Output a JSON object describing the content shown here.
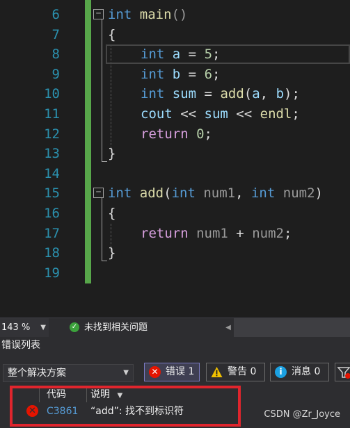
{
  "editor": {
    "line_numbers": [
      "6",
      "7",
      "8",
      "9",
      "10",
      "11",
      "12",
      "13",
      "14",
      "15",
      "16",
      "17",
      "18",
      "19"
    ],
    "code": {
      "l6": {
        "type": "int",
        "name": "main",
        "parens": "()"
      },
      "l7": "{",
      "l8": {
        "type": "int",
        "var": "a",
        "op": " = ",
        "val": "5",
        "end": ";"
      },
      "l9": {
        "type": "int",
        "var": "b",
        "op": " = ",
        "val": "6",
        "end": ";"
      },
      "l10": {
        "type": "int",
        "var": "sum",
        "op": " = ",
        "call": "add",
        "open": "(",
        "a1": "a",
        "sep": ", ",
        "a2": "b",
        "close": ");"
      },
      "l11": {
        "cout": "cout",
        "op1": " << ",
        "var": "sum",
        "op2": " << ",
        "endl": "endl",
        "end": ";"
      },
      "l12": {
        "kw": "return",
        "sp": " ",
        "val": "0",
        "end": ";"
      },
      "l13": "}",
      "l15": {
        "type": "int",
        "name": "add",
        "open": "(",
        "t1": "int",
        "p1": " num1",
        "sep": ", ",
        "t2": "int",
        "p2": " num2",
        "close": ")"
      },
      "l16": "{",
      "l17": {
        "kw": "return",
        "sp": " ",
        "p1": "num1",
        "op": " + ",
        "p2": "num2",
        "end": ";"
      },
      "l18": "}"
    },
    "fold_glyph": "−"
  },
  "status": {
    "zoom": "143 %",
    "issues_text": "未找到相关问题"
  },
  "error_list": {
    "title": "错误列表",
    "scope": "整个解决方案",
    "filters": {
      "errors": "错误 1",
      "warnings": "警告 0",
      "messages": "消息 0"
    },
    "columns": {
      "code": "代码",
      "description": "说明"
    },
    "rows": [
      {
        "code": "C3861",
        "description": "“add”: 找不到标识符"
      }
    ]
  },
  "watermark": "CSDN @Zr_Joyce",
  "colors": {
    "accent_change_bar": "#57a64a",
    "error": "#e51400",
    "highlight_box": "#e0252d",
    "keyword": "#569cd6",
    "function": "#dcdcaa"
  }
}
